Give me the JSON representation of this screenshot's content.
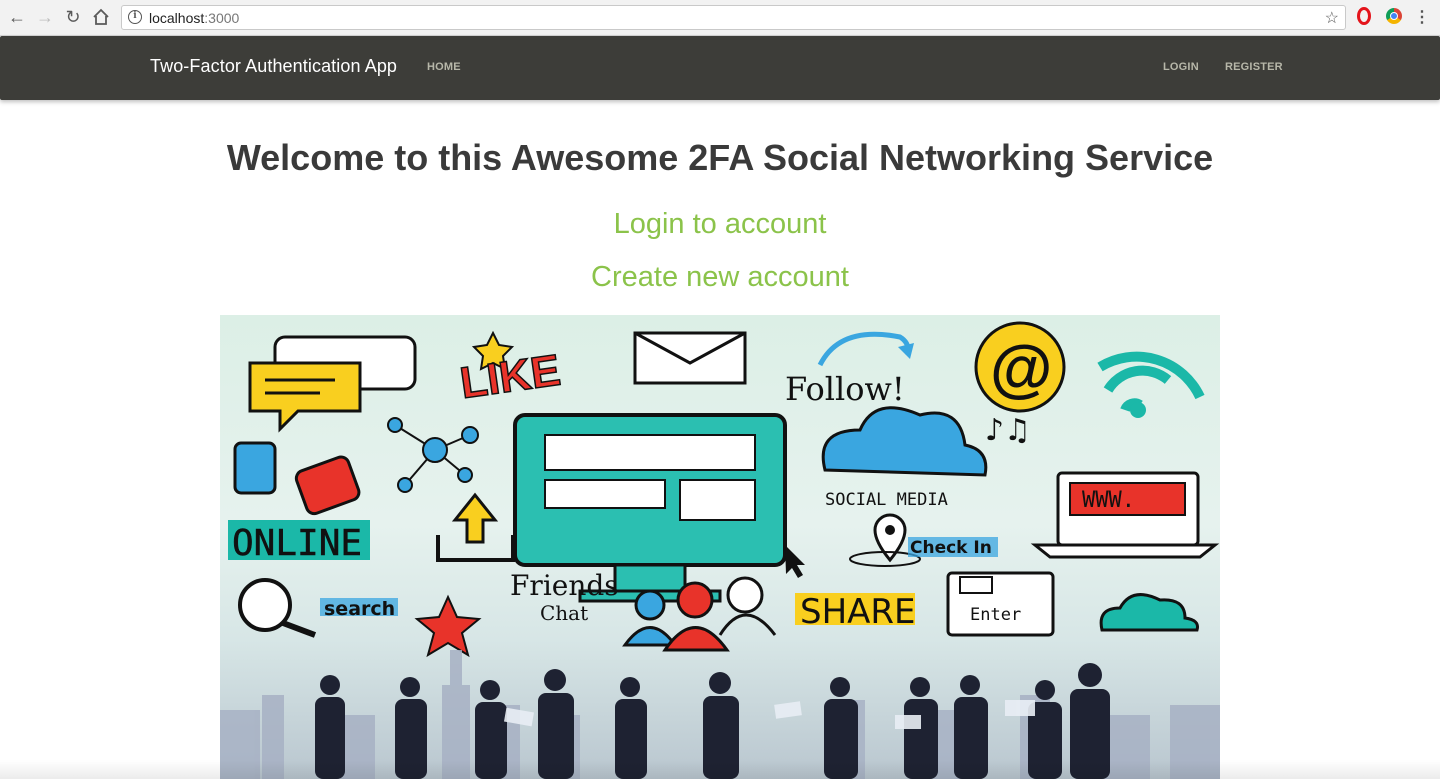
{
  "browser": {
    "url_host": "localhost",
    "url_port": ":3000"
  },
  "navbar": {
    "brand": "Two-Factor Authentication App",
    "home": "HOME",
    "login": "LOGIN",
    "register": "REGISTER"
  },
  "main": {
    "headline": "Welcome to this Awesome 2FA Social Networking Service",
    "login_link": "Login to account",
    "register_link": "Create new account"
  },
  "hero": {
    "words": {
      "like": "LIKE",
      "follow": "Follow!",
      "social_media": "SOCIAL MEDIA",
      "www": "WWW.",
      "online": "ONLINE",
      "check_in": "Check In",
      "friends": "Friends",
      "chat": "Chat",
      "share": "SHARE",
      "search": "search",
      "enter": "Enter",
      "at": "@"
    }
  },
  "colors": {
    "navbar_bg": "#3d3d39",
    "accent_green": "#8bc34a",
    "headline": "#3a3a3a"
  }
}
